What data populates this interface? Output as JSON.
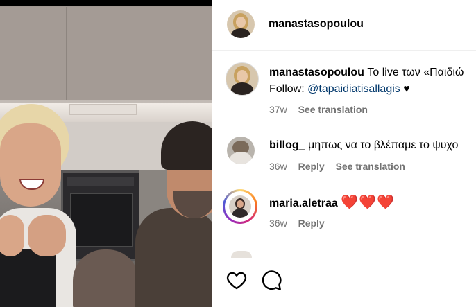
{
  "header": {
    "username": "manastasopoulou"
  },
  "caption": {
    "username": "manastasopoulou",
    "text": "Το live των «Παιδιώ",
    "follow_prefix": "Follow: ",
    "mention": "@tapaidiatisallagis",
    "suffix": " ♥",
    "time": "37w",
    "see_translation": "See translation"
  },
  "comments": [
    {
      "username": "billog_",
      "text": "μηπως να το βλέπαμε το ψυχο",
      "time": "36w",
      "reply": "Reply",
      "see_translation": "See translation"
    },
    {
      "username": "maria.aletraa",
      "text": "❤️❤️❤️",
      "time": "36w",
      "reply": "Reply"
    }
  ],
  "actions": {
    "like_icon": "heart-icon",
    "comment_icon": "comment-icon"
  }
}
